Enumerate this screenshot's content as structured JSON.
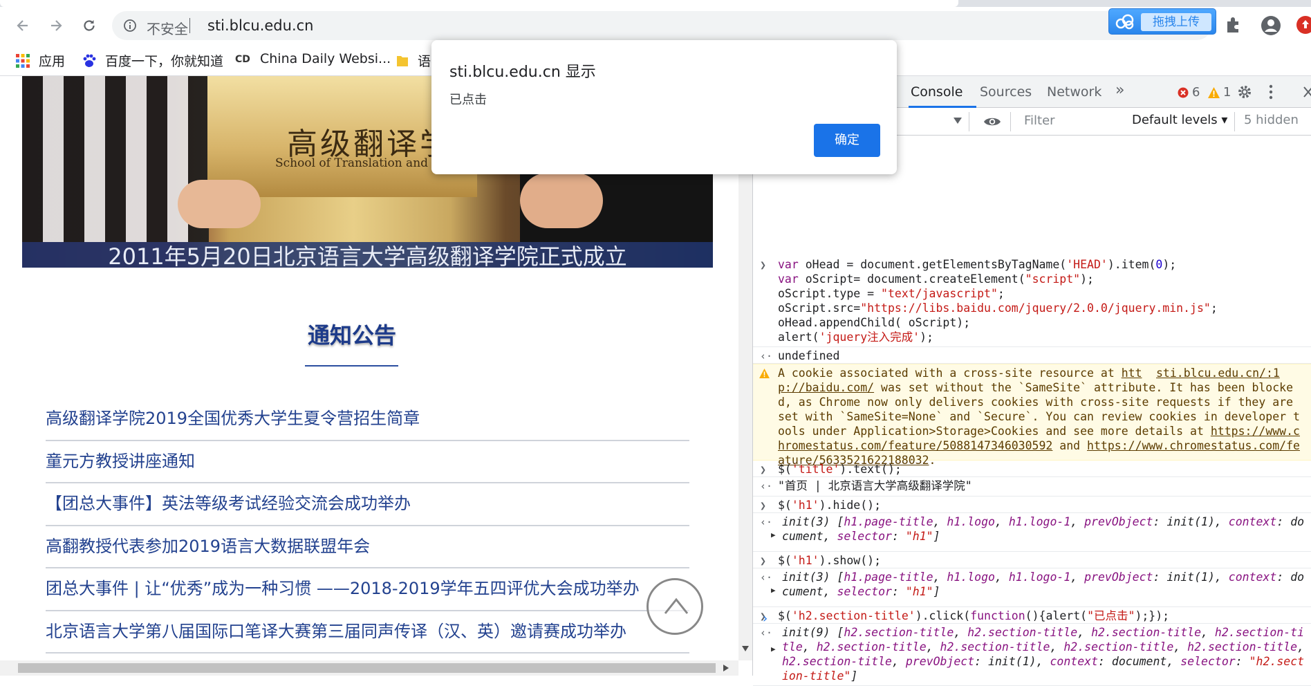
{
  "browser": {
    "address": {
      "security_label": "不安全",
      "url": "sti.blcu.edu.cn"
    },
    "upload_button": "拖拽上传",
    "bookmarks": [
      {
        "label": "应用",
        "icon": "apps-grid-icon"
      },
      {
        "label": "百度一下，你就知道",
        "icon": "baidu-paw-icon"
      },
      {
        "label": "China Daily Websi...",
        "icon": "chinadaily-icon"
      },
      {
        "label": "语",
        "icon": "folder-icon"
      }
    ]
  },
  "page": {
    "banner": {
      "plaque_cn": "高级翻译学",
      "plaque_en": "School of Translation and Interp",
      "caption": "2011年5月20日北京语言大学高级翻译学院正式成立"
    },
    "section_title": "通知公告",
    "news": [
      "高级翻译学院2019全国优秀大学生夏令营招生简章",
      "童元方教授讲座通知",
      "【团总大事件】英法等级考试经验交流会成功举办",
      "高翻教授代表参加2019语言大数据联盟年会",
      "团总大事件 | 让“优秀”成为一种习惯 ——2018-2019学年五四评优大会成功举办",
      "北京语言大学第八届国际口笔译大赛第三届同声传译（汉、英）邀请赛成功举办"
    ]
  },
  "devtools": {
    "tabs": [
      "Console",
      "Sources",
      "Network"
    ],
    "more_tabs": "»",
    "errors": "6",
    "warnings": "1",
    "filter_placeholder": "Filter",
    "levels": "Default levels ▾",
    "hidden": "5 hidden",
    "console": {
      "cmd1": {
        "l1": [
          "var",
          " oHead = document.getElementsByTagName(",
          "'HEAD'",
          ").item(",
          "0",
          ");"
        ],
        "l2": [
          "var",
          " oScript= document.createElement(",
          "\"script\"",
          ");"
        ],
        "l3": [
          "oScript.type = ",
          "\"text/javascript\"",
          ";"
        ],
        "l4": [
          "oScript.src=",
          "\"https://libs.baidu.com/jquery/2.0.0/jquery.min.js\"",
          ";"
        ],
        "l5": "oHead.appendChild( oScript);",
        "l6": [
          "alert(",
          "'jquery注入完成'",
          ");"
        ]
      },
      "result1": "undefined",
      "warning": {
        "text1": "A cookie associated with a cross-site resource at ",
        "link1a": "htt",
        "source": "sti.blcu.edu.cn/:1",
        "link1b": "p://baidu.com/",
        "text2": " was set without the `SameSite` attribute. It has been blocked, as Chrome now only delivers cookies with cross-site requests if they are set with `SameSite=None` and `Secure`. You can review cookies in developer tools under Application>Storage>Cookies and see more details at ",
        "link2": "https://www.chromestatus.com/feature/5088147346030592",
        "and": " and ",
        "link3": "https://www.chromestatus.com/feature/5633521622188032",
        "end": "."
      },
      "cmd2": [
        "$(",
        "'title'",
        ").text();"
      ],
      "result2": "\"首页 | 北京语言大学高级翻译学院\"",
      "cmd3": [
        "$(",
        "'h1'",
        ").hide();"
      ],
      "result3": {
        "head": "init(3) [",
        "items": [
          "h1.page-title",
          "h1.logo",
          "h1.logo-1"
        ],
        "tail1": "prevObject",
        "tail1v": "init(1)",
        "tail2": "context",
        "tail2v": "document",
        "tail3": "selector",
        "tail3v": "\"h1\""
      },
      "cmd4": [
        "$(",
        "'h1'",
        ").show();"
      ],
      "cmd5": [
        "$(",
        "'h2.section-title'",
        ").click(",
        "function",
        "(){alert(",
        "\"已点击\"",
        ");});"
      ],
      "result5": {
        "head": "init(9) [",
        "item": "h2.section-title",
        "tail3v": "\"h2.section-title\""
      },
      "prompt": "›"
    }
  },
  "dialog": {
    "title": "sti.blcu.edu.cn 显示",
    "message": "已点击",
    "ok": "确定"
  }
}
